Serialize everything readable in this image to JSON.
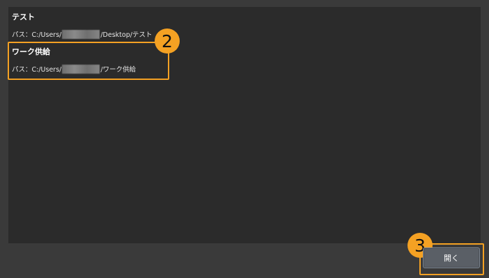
{
  "items": [
    {
      "name": "テスト",
      "path_prefix": "パス：C:/Users/",
      "path_suffix": "/Desktop/テスト"
    },
    {
      "name": "ワーク供給",
      "path_prefix": "パス：C:/Users/",
      "path_suffix": "/ワーク供給"
    }
  ],
  "callouts": [
    "2",
    "3"
  ],
  "open_button": {
    "label": "開く"
  },
  "colors": {
    "accent": "#f4a123",
    "panel": "#2b2b2b",
    "dialog": "#3a3a3a"
  }
}
